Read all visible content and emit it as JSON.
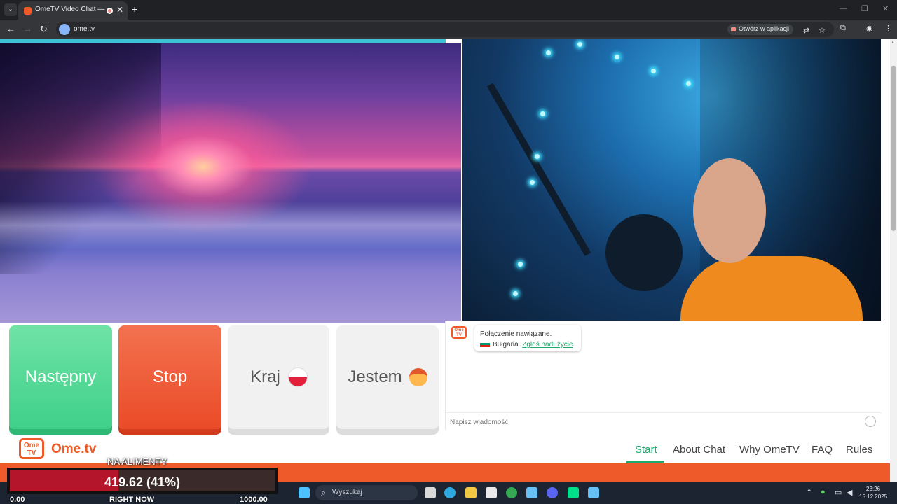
{
  "browser": {
    "tab_title": "OmeTV Video Chat — Omegle",
    "new_tab": "+",
    "url": "ome.tv",
    "open_in_app": "Otwórz w aplikacji",
    "window": {
      "minimize": "—",
      "restore": "❐",
      "close": "✕"
    }
  },
  "controls": {
    "next_label": "Następny",
    "stop_label": "Stop",
    "country_label": "Kraj",
    "gender_label": "Jestem"
  },
  "chat": {
    "logo": "Ome TV",
    "message_status": "Połączenie nawiązane.",
    "country": "Bułgaria.",
    "report_link": "Zgłoś nadużycie",
    "report_suffix": ".",
    "input_placeholder": "Napisz wiadomość"
  },
  "footer": {
    "logo_box": "Ome TV",
    "logo_text": "Ome.tv",
    "nav": [
      "Start",
      "About Chat",
      "Why OmeTV",
      "FAQ",
      "Rules"
    ],
    "active": "Start"
  },
  "overlay": {
    "title": "NA ALIMENTY",
    "value_text": "419.62 (41%)",
    "progress": 0.41,
    "left_label": "0.00",
    "center_label": "RIGHT NOW",
    "right_label": "1000.00"
  },
  "taskbar": {
    "search_placeholder": "Wyszukaj",
    "time": "23:26",
    "date": "15.12.2025"
  },
  "colors": {
    "brand_orange": "#f05a28",
    "accent_green": "#1ea86b",
    "next_green": "#3fd089",
    "stop_red": "#ea4b28"
  }
}
